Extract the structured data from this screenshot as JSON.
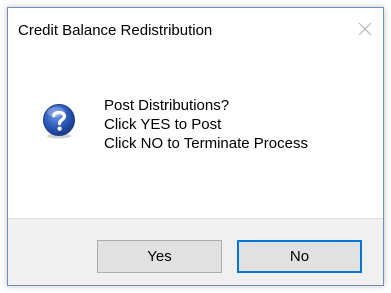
{
  "dialog": {
    "title": "Credit Balance Redistribution",
    "close_icon": "close-icon",
    "message_icon": "question-icon",
    "message_lines": [
      "Post Distributions?",
      "Click YES to Post",
      "Click NO to Terminate Process"
    ],
    "buttons": {
      "yes_label": "Yes",
      "no_label": "No"
    },
    "default_button": "No"
  },
  "colors": {
    "window_border": "#6d8fbf",
    "footer_bg": "#f0f0f0",
    "button_bg": "#e1e1e1",
    "focus_border": "#0078d7",
    "icon_blue": "#2b58b8"
  }
}
